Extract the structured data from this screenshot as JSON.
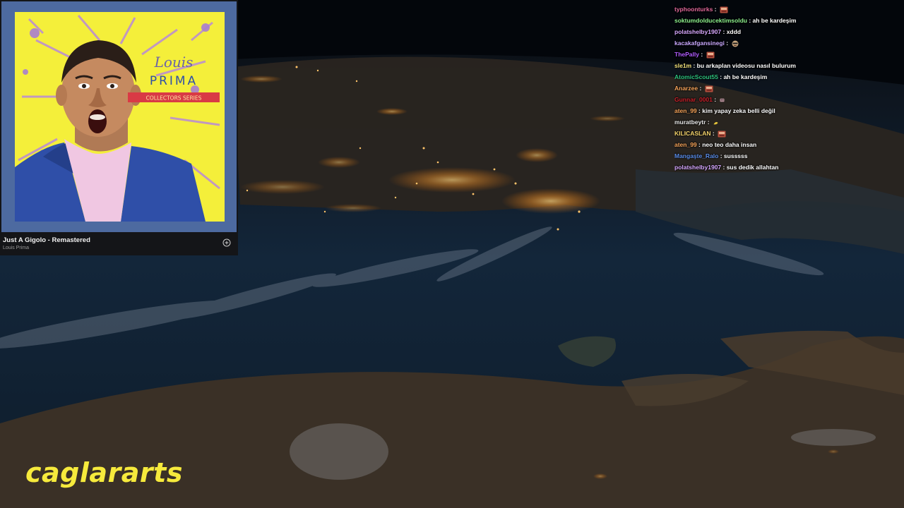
{
  "now_playing": {
    "album_art": {
      "artist_script": "Louis",
      "artist_caps": "PRIMA",
      "series": "COLLECTORS SERIES"
    },
    "track_title": "Just A Gigolo - Remastered",
    "artist": "Louis Prima",
    "add_icon": "plus-circle-icon"
  },
  "chat": {
    "messages": [
      {
        "user": "typhoonturks",
        "sep": " : ",
        "text": "",
        "emote": "emote-icon",
        "color": "#e0689a"
      },
      {
        "user": "soktumdolducektimsoldu",
        "sep": " : ",
        "text": "ah be kardeşim",
        "emote": "",
        "color": "#8cf08c"
      },
      {
        "user": "polatshelby1907",
        "sep": " : ",
        "text": "xddd",
        "emote": "",
        "color": "#d6a8ff"
      },
      {
        "user": "kacakafgansinegi",
        "sep": " : ",
        "text": "",
        "emote": "face-emote-icon",
        "color": "#c9a8ff"
      },
      {
        "user": "ThePally",
        "sep": " : ",
        "text": "",
        "emote": "emote-icon",
        "color": "#b05cff"
      },
      {
        "user": "sle1m",
        "sep": " : ",
        "text": "bu arkaplan videosu nasıl bulurum",
        "emote": "",
        "color": "#f4e27a"
      },
      {
        "user": "AtomicScout55",
        "sep": " : ",
        "text": "ah be kardeşim",
        "emote": "",
        "color": "#2ec27e"
      },
      {
        "user": "Anarzee",
        "sep": " : ",
        "text": "",
        "emote": "emote-icon",
        "color": "#f6a45a"
      },
      {
        "user": "Gunnar_0001",
        "sep": " : ",
        "text": "",
        "emote": "small-emote-icon",
        "color": "#c8202a"
      },
      {
        "user": "aten_99",
        "sep": " : ",
        "text": "kim yapay zeka belli değil",
        "emote": "",
        "color": "#f6a45a"
      },
      {
        "user": "muratbeytr",
        "sep": " : ",
        "text": "",
        "emote": "yellow-emote-icon",
        "color": "#e8e8e8"
      },
      {
        "user": "KILICASLAN",
        "sep": " : ",
        "text": "",
        "emote": "emote-icon",
        "color": "#f4d36b"
      },
      {
        "user": "aten_99",
        "sep": " : ",
        "text": "neo teo daha insan",
        "emote": "",
        "color": "#f6a45a"
      },
      {
        "user": "Mangaşte_Ralo",
        "sep": " : ",
        "text": "susssss",
        "emote": "",
        "color": "#5b8de8"
      },
      {
        "user": "polatshelby1907",
        "sep": " : ",
        "text": "sus dedik allahtan",
        "emote": "",
        "color": "#d6a8ff"
      }
    ]
  },
  "watermark": {
    "text": "caglararts",
    "color": "#f6ea3c"
  },
  "colors": {
    "album_frame": "#4d6aa0",
    "album_bg": "#f4ef3a",
    "card_bg": "#141518"
  }
}
